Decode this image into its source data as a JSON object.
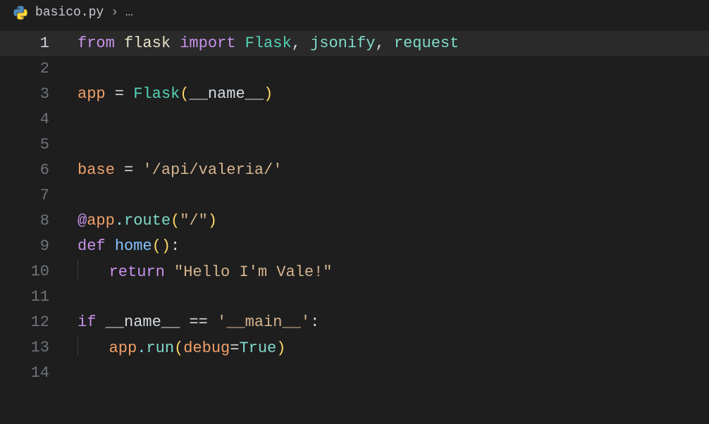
{
  "breadcrumb": {
    "file_name": "basico.py",
    "chevron": "›",
    "more": "…"
  },
  "editor": {
    "active_line": 1,
    "line_count": 14,
    "tokens": {
      "l1": {
        "from": "from",
        "flask": "flask",
        "import": "import",
        "Flask": "Flask",
        "c1": ", ",
        "jsonify": "jsonify",
        "c2": ", ",
        "request": "request"
      },
      "l3": {
        "app": "app",
        "eq": " = ",
        "Flask": "Flask",
        "lp": "(",
        "name": "__name__",
        "rp": ")"
      },
      "l6": {
        "base": "base",
        "eq": " = ",
        "str": "'/api/valeria/'"
      },
      "l8": {
        "at": "@",
        "app": "app",
        "dot": ".",
        "route": "route",
        "lp": "(",
        "str": "\"/\"",
        "rp": ")"
      },
      "l9": {
        "def": "def",
        "sp": " ",
        "home": "home",
        "lp": "(",
        "rp": ")",
        "colon": ":"
      },
      "l10": {
        "ret": "return",
        "sp": " ",
        "str": "\"Hello I'm Vale!\""
      },
      "l12": {
        "if": "if",
        "sp": " ",
        "name": "__name__",
        "eq": " == ",
        "str": "'__main__'",
        "colon": ":"
      },
      "l13": {
        "app": "app",
        "dot": ".",
        "run": "run",
        "lp": "(",
        "debug": "debug",
        "asg": "=",
        "True": "True",
        "rp": ")"
      }
    }
  }
}
